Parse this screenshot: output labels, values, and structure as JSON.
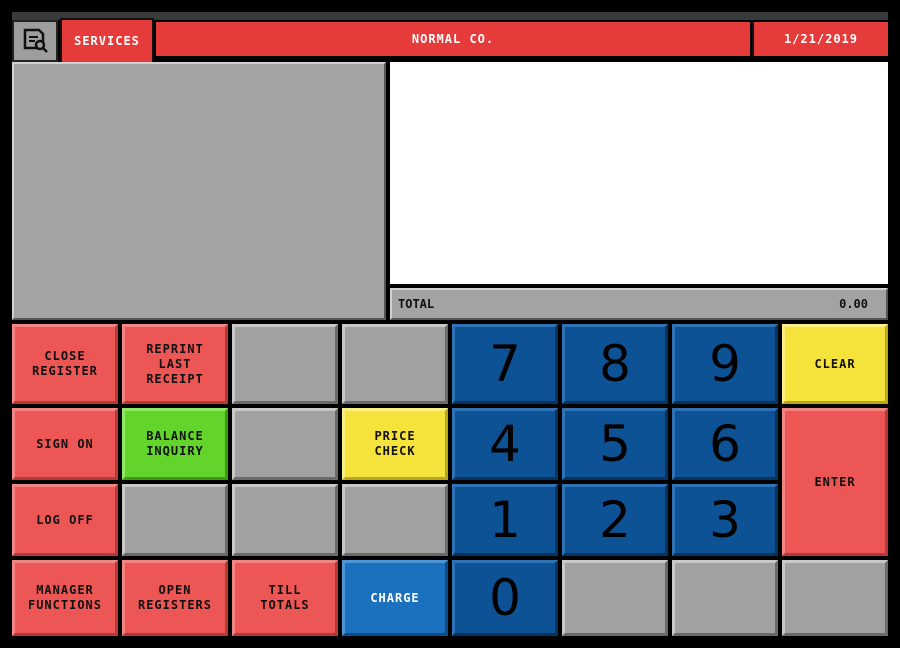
{
  "header": {
    "menu_icon": "receipt-search-icon",
    "services_label": "SERVICES",
    "company_name": "NORMAL CO.",
    "date": "1/21/2019"
  },
  "total": {
    "label": "TOTAL",
    "amount": "0.00"
  },
  "buttons": {
    "close_register": "CLOSE\nREGISTER",
    "reprint_last_receipt": "REPRINT\nLAST\nRECEIPT",
    "sign_on": "SIGN ON",
    "balance_inquiry": "BALANCE\nINQUIRY",
    "price_check": "PRICE\nCHECK",
    "log_off": "LOG OFF",
    "manager_functions": "MANAGER\nFUNCTIONS",
    "open_registers": "OPEN\nREGISTERS",
    "till_totals": "TILL\nTOTALS",
    "charge": "CHARGE",
    "clear": "CLEAR",
    "enter": "ENTER"
  },
  "keypad": {
    "k7": "7",
    "k8": "8",
    "k9": "9",
    "k4": "4",
    "k5": "5",
    "k6": "6",
    "k1": "1",
    "k2": "2",
    "k3": "3",
    "k0": "0"
  },
  "colors": {
    "accent_red": "#e53b3b",
    "button_red": "#ec5654",
    "keypad_blue": "#0e5296",
    "charge_blue": "#1b71bd",
    "button_green": "#63d42b",
    "button_yellow": "#f5e23b",
    "button_gray": "#a1a1a1"
  }
}
